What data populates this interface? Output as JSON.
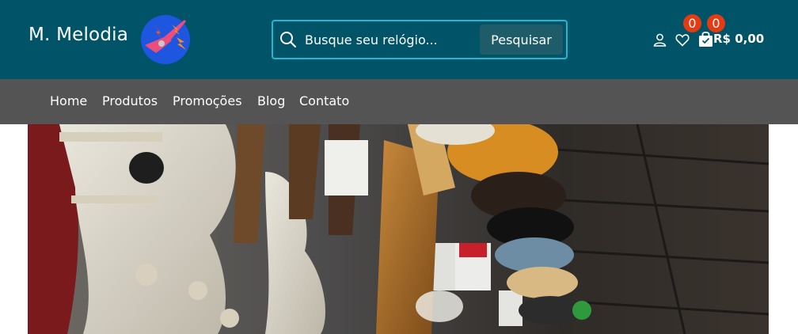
{
  "header": {
    "brand": "M. Melodia",
    "background_color": "#015467",
    "logo_icon": "electric-guitar-logo"
  },
  "search": {
    "placeholder": "Busque seu relógio...",
    "button_label": "Pesquisar",
    "border_color": "#23b7d2"
  },
  "account": {
    "icons": [
      "user-icon",
      "heart-icon",
      "shopping-bag-icon"
    ],
    "wishlist_count": "0",
    "cart_count": "0",
    "cart_total": "R$ 0,00",
    "badge_color": "#e33b12"
  },
  "nav": {
    "background_color": "#545454",
    "items": [
      {
        "label": "Home"
      },
      {
        "label": "Produtos"
      },
      {
        "label": "Promoções"
      },
      {
        "label": "Blog"
      },
      {
        "label": "Contato"
      }
    ]
  },
  "hero": {
    "alt_subject": "guitar-store-display"
  }
}
